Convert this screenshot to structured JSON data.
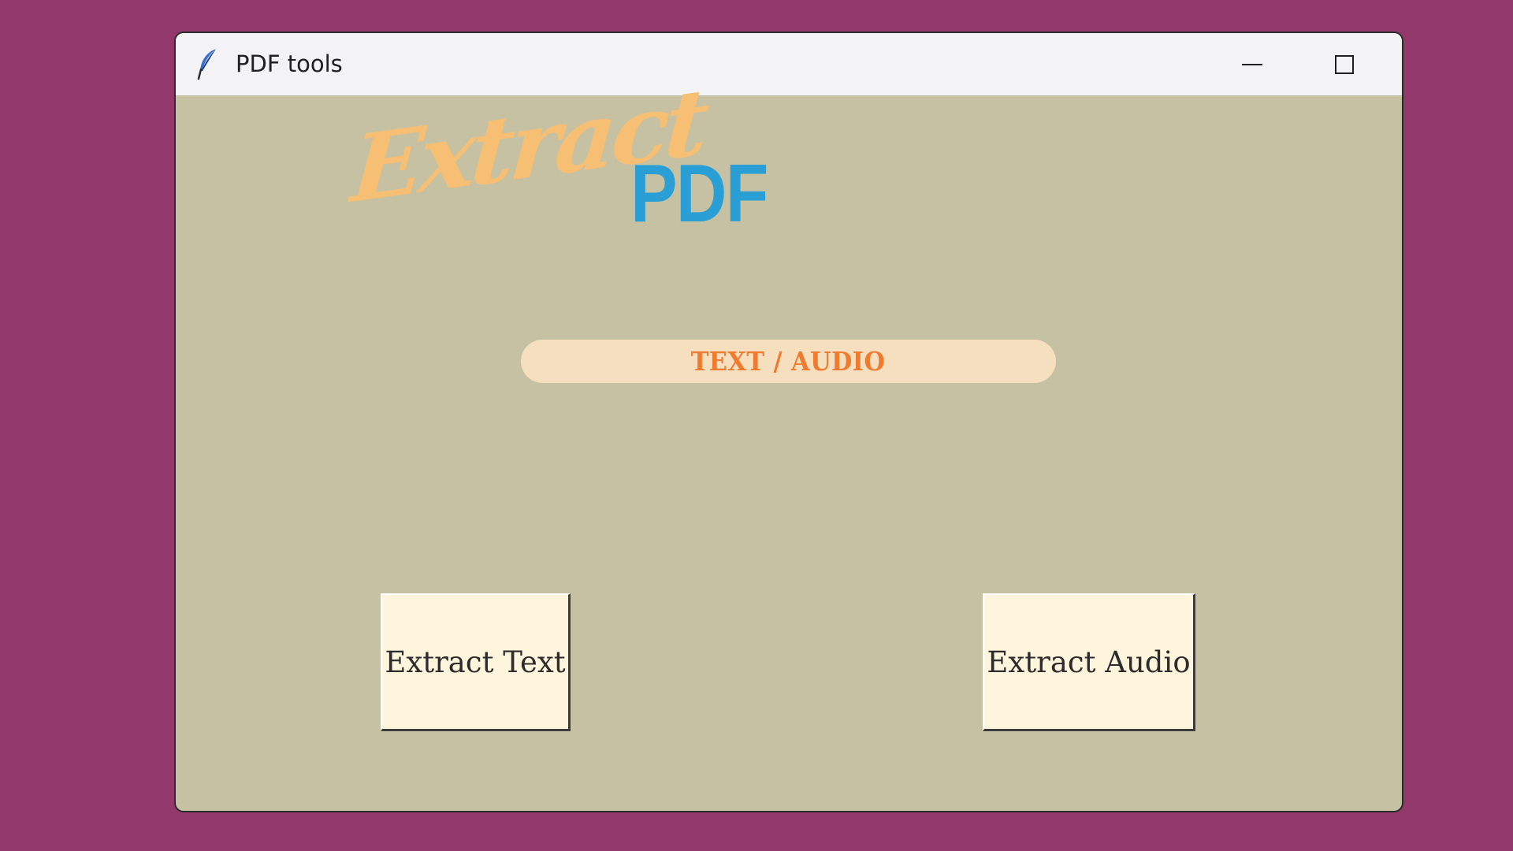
{
  "window": {
    "title": "PDF tools",
    "icon": "feather-icon",
    "controls": {
      "minimize": "minimize-icon",
      "maximize": "maximize-icon",
      "close": "close-icon"
    }
  },
  "logo": {
    "word1": "Extract",
    "word2": "PDF",
    "subtitle": "TEXT / AUDIO"
  },
  "actions": {
    "extract_text_label": "Extract Text",
    "extract_audio_label": "Extract Audio"
  },
  "colors": {
    "desktop": "#93386a",
    "window_bg": "#c5c1a2",
    "titlebar": "#f3f3f6",
    "logo_orange": "#f6bf73",
    "logo_blue": "#2a9fd6",
    "subtitle_bg": "#f6dfbf",
    "subtitle_text": "#f07a2e",
    "button_bg": "#fff5dc"
  }
}
